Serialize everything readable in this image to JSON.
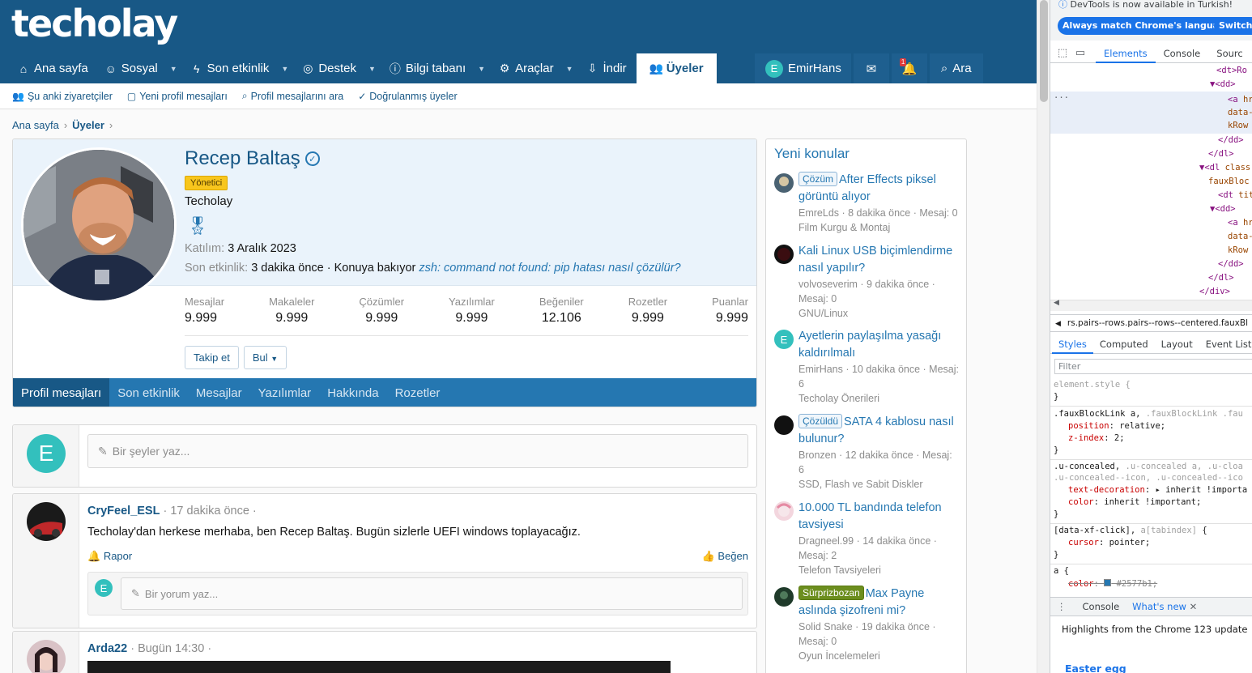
{
  "site": {
    "logo": "techolay",
    "nav": [
      {
        "icon": "⌂",
        "label": "Ana sayfa",
        "caret": false
      },
      {
        "icon": "☺",
        "label": "Sosyal",
        "caret": true
      },
      {
        "icon": "ϟ",
        "label": "Son etkinlik",
        "caret": true
      },
      {
        "icon": "◎",
        "label": "Destek",
        "caret": true
      },
      {
        "icon": "ⓘ",
        "label": "Bilgi tabanı",
        "caret": true
      },
      {
        "icon": "⚙",
        "label": "Araçlar",
        "caret": true
      },
      {
        "icon": "⇩",
        "label": "İndir",
        "caret": false
      },
      {
        "icon": "👥",
        "label": "Üyeler",
        "caret": false
      }
    ],
    "user": {
      "initial": "E",
      "name": "EmirHans",
      "alerts_badge": "1",
      "search_label": "Ara"
    },
    "subnav": [
      {
        "icon": "👥",
        "label": "Şu anki ziyaretçiler"
      },
      {
        "icon": "▢",
        "label": "Yeni profil mesajları"
      },
      {
        "icon": "⌕",
        "label": "Profil mesajlarını ara"
      },
      {
        "icon": "✓",
        "label": "Doğrulanmış üyeler"
      }
    ],
    "breadcrumb": {
      "home": "Ana sayfa",
      "current": "Üyeler"
    }
  },
  "profile": {
    "name": "Recep Baltaş",
    "role": "Yönetici",
    "title": "Techolay",
    "joined_label": "Katılım:",
    "joined_value": "3 Aralık 2023",
    "last_label": "Son etkinlik:",
    "last_value": "3 dakika önce · Konuya bakıyor",
    "last_topic": "zsh: command not found: pip hatası nasıl çözülür?",
    "stats": [
      {
        "label": "Mesajlar",
        "value": "9.999"
      },
      {
        "label": "Makaleler",
        "value": "9.999"
      },
      {
        "label": "Çözümler",
        "value": "9.999"
      },
      {
        "label": "Yazılımlar",
        "value": "9.999"
      },
      {
        "label": "Beğeniler",
        "value": "12.106"
      },
      {
        "label": "Rozetler",
        "value": "9.999"
      },
      {
        "label": "Puanlar",
        "value": "9.999"
      }
    ],
    "follow": "Takip et",
    "find": "Bul",
    "tabs": [
      "Profil mesajları",
      "Son etkinlik",
      "Mesajlar",
      "Yazılımlar",
      "Hakkında",
      "Rozetler"
    ]
  },
  "editor": {
    "initial": "E",
    "placeholder": "Bir şeyler yaz..."
  },
  "messages": [
    {
      "author": "CryFeel_ESL",
      "time": "17 dakika önce",
      "body": "Techolay'dan herkese merhaba, ben Recep Baltaş. Bugün sizlerle UEFI windows toplayacağız.",
      "report": "Rapor",
      "like": "Beğen",
      "comment_initial": "E",
      "comment_placeholder": "Bir yorum yaz..."
    },
    {
      "author": "Arda22",
      "time": "Bugün 14:30"
    }
  ],
  "sidebar": {
    "title": "Yeni konular",
    "threads": [
      {
        "label": "Çözüm",
        "label_type": "o",
        "title": "After Effects piksel görüntü alıyor",
        "meta": "EmreLds · 8 dakika önce · Mesaj: 0",
        "forum": "Film Kurgu & Montaj"
      },
      {
        "label": "",
        "label_type": "",
        "title": "Kali Linux USB biçimlendirme nasıl yapılır?",
        "meta": "volvoseverim · 9 dakika önce · Mesaj: 0",
        "forum": "GNU/Linux"
      },
      {
        "label": "",
        "label_type": "",
        "title": "Ayetlerin paylaşılma yasağı kaldırılmalı",
        "meta": "EmirHans · 10 dakika önce · Mesaj: 6",
        "forum": "Techolay Önerileri"
      },
      {
        "label": "Çözüldü",
        "label_type": "o",
        "title": "SATA 4 kablosu nasıl bulunur?",
        "meta": "Bronzen · 12 dakika önce · Mesaj: 6",
        "forum": "SSD, Flash ve Sabit Diskler"
      },
      {
        "label": "",
        "label_type": "",
        "title": "10.000 TL bandında telefon tavsiyesi",
        "meta": "Dragneel.99 · 14 dakika önce · Mesaj: 2",
        "forum": "Telefon Tavsiyeleri"
      },
      {
        "label": "Sürprizbozan",
        "label_type": "g",
        "title": "Max Payne aslında şizofreni mi?",
        "meta": "Solid Snake · 19 dakika önce · Mesaj: 0",
        "forum": "Oyun İncelemeleri"
      }
    ]
  },
  "devtools": {
    "notice": "DevTools is now available in Turkish!",
    "btn_match": "Always match Chrome's language",
    "btn_switch": "Switch D",
    "tabs": [
      "Elements",
      "Console",
      "Sourc"
    ],
    "breadcrumb": "rs.pairs--rows.pairs--rows--centered.fauxBl",
    "style_tabs": [
      "Styles",
      "Computed",
      "Layout",
      "Event Lister"
    ],
    "filter_placeholder": "Filter",
    "drawer_tabs": [
      "Console",
      "What's new"
    ],
    "highlights": "Highlights from the Chrome 123 update",
    "easter_egg": "Easter egg"
  }
}
